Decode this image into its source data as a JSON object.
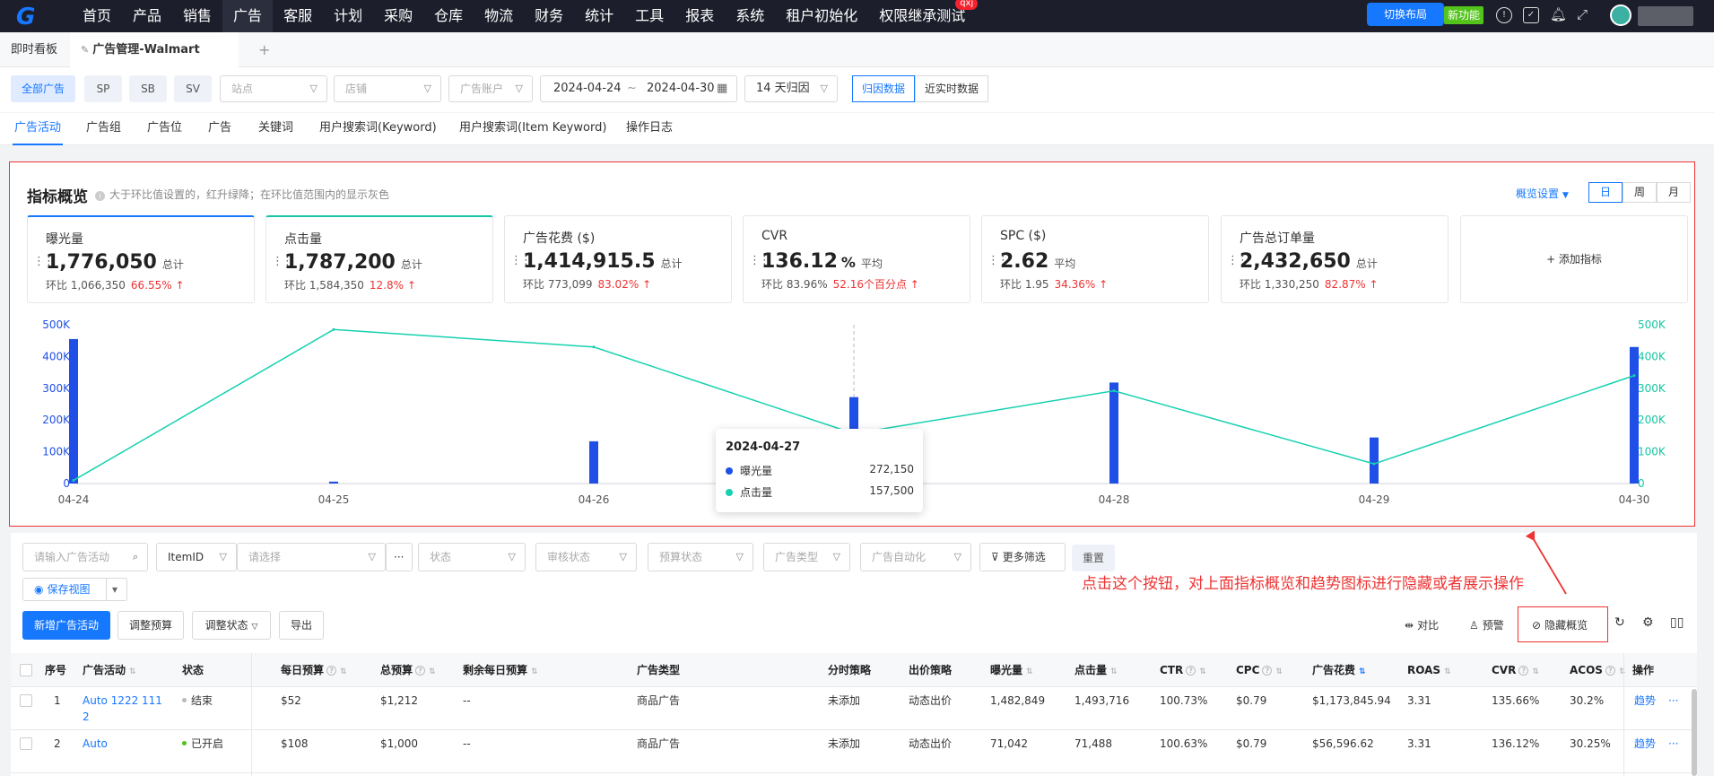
{
  "colors": {
    "accent": "#1677ff",
    "impressions": "#1f4fe6",
    "clicks": "#16d1b0",
    "danger": "#e33333",
    "success": "#52c41a"
  },
  "nav": {
    "logo": "G",
    "items": [
      "首页",
      "产品",
      "销售",
      "广告",
      "客服",
      "计划",
      "采购",
      "仓库",
      "物流",
      "财务",
      "统计",
      "工具",
      "报表",
      "系统",
      "租户初始化",
      "权限继承测试"
    ],
    "active_index": 3,
    "badge": "qxj",
    "switch_layout": "切换布局",
    "new_feature": "新功能",
    "icons": [
      "alert-icon",
      "calendar-check-icon",
      "bell-icon",
      "fullscreen-icon"
    ]
  },
  "page_tabs": {
    "dashboard": "即时看板",
    "current": "广告管理-Walmart",
    "pin_icon": "pin-icon",
    "add": "+"
  },
  "filters": {
    "all_ads": "全部广告",
    "sp": "SP",
    "sb": "SB",
    "sv": "SV",
    "site_placeholder": "站点",
    "shop_placeholder": "店铺",
    "account_placeholder": "广告账户",
    "start_date": "2024-04-24",
    "date_sep": "~",
    "end_date": "2024-04-30",
    "attribution": "14 天归因",
    "attributed_data": "归因数据",
    "realtime_data": "近实时数据"
  },
  "sub_tabs": [
    "广告活动",
    "广告组",
    "广告位",
    "广告",
    "关键词",
    "用户搜索词(Keyword)",
    "用户搜索词(Item Keyword)",
    "操作日志"
  ],
  "overview": {
    "title": "指标概览",
    "tip": "大于环比值设置的，红升绿降；在环比值范围内的显示灰色",
    "settings": "概览设置",
    "periods": [
      "日",
      "周",
      "月"
    ],
    "active_period": 0,
    "add_metric": "+ 添加指标",
    "cards": [
      {
        "name": "曝光量",
        "value": "1,776,050",
        "unit": "",
        "agg": "总计",
        "cmp_label": "环比",
        "cmp_value": "1,066,350",
        "pct": "66.55%",
        "arrow": "↑"
      },
      {
        "name": "点击量",
        "value": "1,787,200",
        "unit": "",
        "agg": "总计",
        "cmp_label": "环比",
        "cmp_value": "1,584,350",
        "pct": "12.8%",
        "arrow": "↑"
      },
      {
        "name": "广告花费 ($)",
        "value": "1,414,915.5",
        "unit": "",
        "agg": "总计",
        "cmp_label": "环比",
        "cmp_value": "773,099",
        "pct": "83.02%",
        "arrow": "↑"
      },
      {
        "name": "CVR",
        "value": "136.12",
        "unit": "%",
        "agg": "平均",
        "cmp_label": "环比",
        "cmp_value": "83.96%",
        "pct": "52.16个百分点",
        "arrow": "↑"
      },
      {
        "name": "SPC ($)",
        "value": "2.62",
        "unit": "",
        "agg": "平均",
        "cmp_label": "环比",
        "cmp_value": "1.95",
        "pct": "34.36%",
        "arrow": "↑"
      },
      {
        "name": "广告总订单量",
        "value": "2,432,650",
        "unit": "",
        "agg": "总计",
        "cmp_label": "环比",
        "cmp_value": "1,330,250",
        "pct": "82.87%",
        "arrow": "↑"
      }
    ]
  },
  "chart_data": {
    "type": "bar",
    "categories": [
      "04-24",
      "04-25",
      "04-26",
      "04-27",
      "04-28",
      "04-29",
      "04-30"
    ],
    "y_ticks": [
      "0",
      "100K",
      "200K",
      "300K",
      "400K",
      "500K"
    ],
    "ylim": [
      0,
      500000
    ],
    "series": [
      {
        "name": "曝光量",
        "kind": "bar",
        "axis": "left",
        "values": [
          455000,
          6000,
          133000,
          272150,
          318000,
          145000,
          430000
        ]
      },
      {
        "name": "点击量",
        "kind": "line",
        "axis": "right",
        "values": [
          10000,
          485000,
          430000,
          157500,
          292000,
          62000,
          340000
        ]
      }
    ],
    "tooltip": {
      "date": "2024-04-27",
      "rows": [
        {
          "name": "曝光量",
          "value": "272,150"
        },
        {
          "name": "点击量",
          "value": "157,500"
        }
      ]
    }
  },
  "table_filters": {
    "search_placeholder": "请输入广告活动",
    "itemid": "ItemID",
    "select_placeholder": "请选择",
    "more_dots": "···",
    "status": "状态",
    "review_status": "审核状态",
    "budget_status": "预算状态",
    "ad_type": "广告类型",
    "ad_auto": "广告自动化",
    "more_filters": "更多筛选",
    "reset": "重置",
    "save_view": "保存视图"
  },
  "actions": {
    "new_campaign": "新增广告活动",
    "adjust_budget": "调整预算",
    "adjust_status": "调整状态",
    "export": "导出",
    "compare": "对比",
    "alert": "预警",
    "hide_overview": "隐藏概览"
  },
  "annotation": "点击这个按钮，对上面指标概览和趋势图标进行隐藏或者展示操作",
  "table": {
    "headers": [
      "序号",
      "广告活动",
      "状态",
      "每日预算",
      "总预算",
      "剩余每日预算",
      "广告类型",
      "分时策略",
      "出价策略",
      "曝光量",
      "点击量",
      "CTR",
      "CPC",
      "广告花费",
      "ROAS",
      "CVR",
      "ACOS",
      "操作"
    ],
    "rows": [
      {
        "no": "1",
        "campaign": "Auto  1222 111",
        "campaign2": "2",
        "status": "结束",
        "status_color": "#bbbbbb",
        "daily_budget": "$52",
        "total_budget": "$1,212",
        "remaining": "--",
        "ad_type": "商品广告",
        "time_strategy": "未添加",
        "bid_strategy": "动态出价",
        "impressions": "1,482,849",
        "clicks": "1,493,716",
        "ctr": "100.73%",
        "cpc": "$0.79",
        "spend": "$1,173,845.94",
        "roas": "3.31",
        "cvr": "135.66%",
        "acos": "30.2%",
        "op": "趋势"
      },
      {
        "no": "2",
        "campaign": "Auto",
        "campaign2": "",
        "status": "已开启",
        "status_color": "#52c41a",
        "daily_budget": "$108",
        "total_budget": "$1,000",
        "remaining": "--",
        "ad_type": "商品广告",
        "time_strategy": "未添加",
        "bid_strategy": "动态出价",
        "impressions": "71,042",
        "clicks": "71,488",
        "ctr": "100.63%",
        "cpc": "$0.79",
        "spend": "$56,596.62",
        "roas": "3.31",
        "cvr": "136.12%",
        "acos": "30.25%",
        "op": "趋势"
      }
    ]
  }
}
